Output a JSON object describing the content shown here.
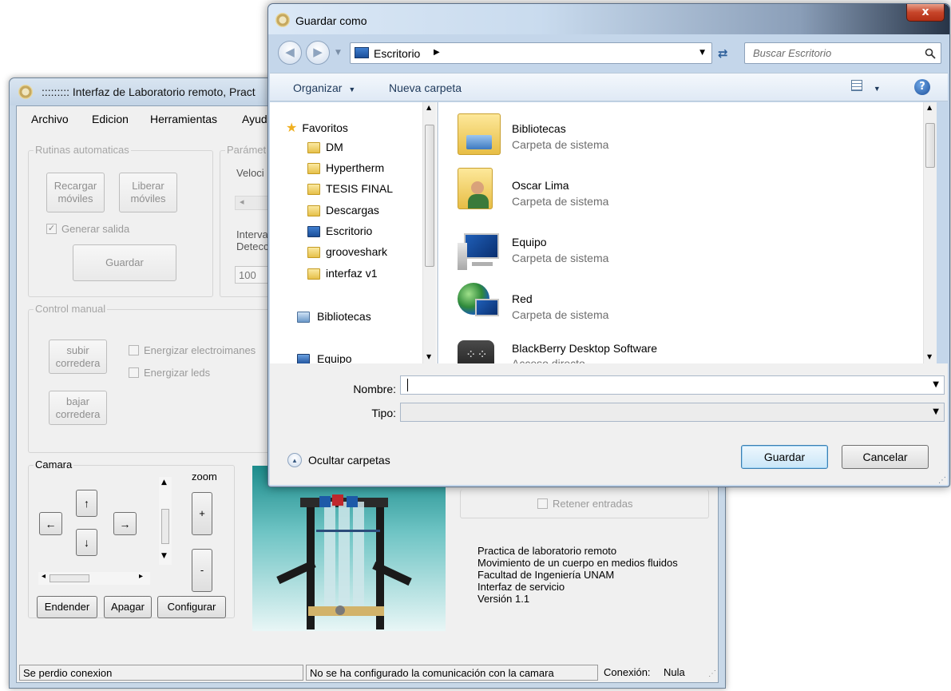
{
  "main": {
    "title": "::::::::: Interfaz de Laboratorio remoto, Pract",
    "menu": [
      "Archivo",
      "Edicion",
      "Herramientas",
      "Ayud"
    ],
    "rutinas": {
      "legend": "Rutinas automaticas",
      "recargar": "Recargar\nmóviles",
      "liberar": "Liberar\nmóviles",
      "generar_salida": "Generar salida",
      "guardar": "Guardar"
    },
    "parametros": {
      "legend": "Parámet",
      "velocidad": "Veloci",
      "intervalo": "Interva\nDetecc",
      "value": "100"
    },
    "control": {
      "legend": "Control manual",
      "subir": "subir\ncorredera",
      "bajar": "bajar\ncorredera",
      "energizar_electro": "Energizar electroimanes",
      "energizar_leds": "Energizar leds"
    },
    "camara": {
      "legend": "Camara",
      "zoom": "zoom",
      "up": "↑",
      "down": "↓",
      "left": "←",
      "right": "→",
      "plus": "+",
      "minus": "-",
      "encender": "Endender",
      "apagar": "Apagar",
      "configurar": "Configurar"
    },
    "retener": "Retener entradas",
    "info": [
      "Practica de laboratorio remoto",
      "Movimiento de un cuerpo en medios fluidos",
      "Facultad de Ingeniería UNAM",
      "Interfaz de servicio",
      "Versión 1.1"
    ],
    "status": {
      "left": "Se perdio conexion",
      "middle": "No se ha configurado la comunicación con la camara",
      "conexion_label": "Conexión:",
      "conexion_value": "Nula"
    }
  },
  "dialog": {
    "title": "Guardar como",
    "close": "x",
    "address": "Escritorio",
    "search_placeholder": "Buscar Escritorio",
    "organizar": "Organizar",
    "nueva_carpeta": "Nueva carpeta",
    "nav": {
      "favoritos": "Favoritos",
      "items": [
        "DM",
        "Hypertherm",
        "TESIS FINAL",
        "Descargas",
        "Escritorio",
        "grooveshark",
        "interfaz v1"
      ],
      "bibliotecas": "Bibliotecas",
      "equipo": "Equipo"
    },
    "files": [
      {
        "name": "Bibliotecas",
        "type": "Carpeta de sistema"
      },
      {
        "name": "Oscar Lima",
        "type": "Carpeta de sistema"
      },
      {
        "name": "Equipo",
        "type": "Carpeta de sistema"
      },
      {
        "name": "Red",
        "type": "Carpeta de sistema"
      },
      {
        "name": "BlackBerry Desktop Software",
        "type": "Acceso directo"
      }
    ],
    "nombre_label": "Nombre:",
    "nombre_value": "",
    "tipo_label": "Tipo:",
    "tipo_value": "",
    "ocultar": "Ocultar carpetas",
    "guardar": "Guardar",
    "cancelar": "Cancelar"
  }
}
